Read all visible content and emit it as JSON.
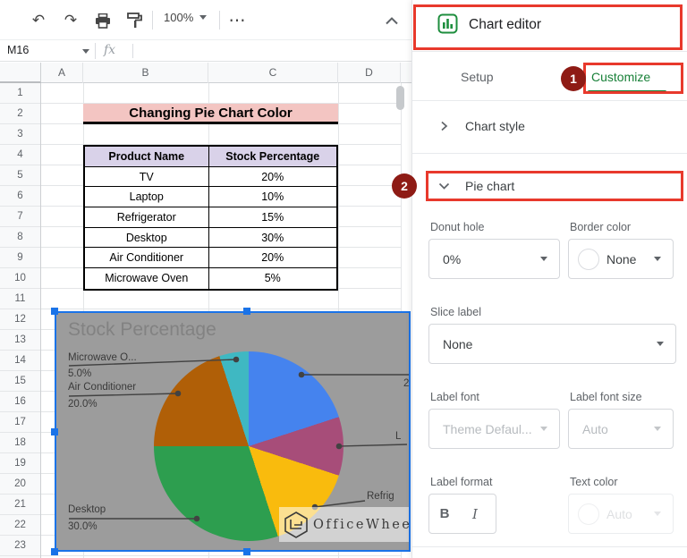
{
  "toolbar": {
    "zoom_level": "100%",
    "more": "⋯"
  },
  "formula_bar": {
    "name_box": "M16",
    "fx": "fx"
  },
  "grid": {
    "columns": [
      "A",
      "B",
      "C",
      "D"
    ],
    "rows": [
      "1",
      "2",
      "3",
      "4",
      "5",
      "6",
      "7",
      "8",
      "9",
      "10",
      "11",
      "12",
      "13",
      "14",
      "15",
      "16",
      "17",
      "18",
      "19",
      "20",
      "21",
      "22",
      "23"
    ]
  },
  "sheet": {
    "title": "Changing Pie Chart Color",
    "table": {
      "headers": [
        "Product Name",
        "Stock Percentage"
      ],
      "rows": [
        [
          "TV",
          "20%"
        ],
        [
          "Laptop",
          "10%"
        ],
        [
          "Refrigerator",
          "15%"
        ],
        [
          "Desktop",
          "30%"
        ],
        [
          "Air Conditioner",
          "20%"
        ],
        [
          "Microwave Oven",
          "5%"
        ]
      ]
    }
  },
  "chart": {
    "title": "Stock Percentage",
    "labels": {
      "microwave_name": "Microwave O...",
      "microwave_pct": "5.0%",
      "air_name": "Air Conditioner",
      "air_pct": "20.0%",
      "desktop_name": "Desktop",
      "desktop_pct": "30.0%",
      "laptop_clipped": "L",
      "refrigerator_clipped": "Refrig",
      "tv_pct_clipped": "2"
    },
    "watermark": "OfficeWheel"
  },
  "chart_data": {
    "type": "pie",
    "title": "Stock Percentage",
    "categories": [
      "TV",
      "Laptop",
      "Refrigerator",
      "Desktop",
      "Air Conditioner",
      "Microwave Oven"
    ],
    "values": [
      20,
      10,
      15,
      30,
      20,
      5
    ],
    "colors": [
      "#4583ee",
      "#a74d79",
      "#f9bb0d",
      "#2d9e4f",
      "#b05f07",
      "#3fb8c2"
    ],
    "start_angle_deg": 0,
    "legend": "none",
    "label_style": "callout lines with name and percent"
  },
  "panel": {
    "title": "Chart editor",
    "tabs": {
      "setup": "Setup",
      "customize": "Customize"
    },
    "badges": {
      "step1": "1",
      "step2": "2"
    },
    "sections": {
      "chart_style": "Chart style",
      "pie_chart": "Pie chart"
    },
    "fields": {
      "donut_hole": {
        "label": "Donut hole",
        "value": "0%"
      },
      "border_color": {
        "label": "Border color",
        "value": "None"
      },
      "slice_label": {
        "label": "Slice label",
        "value": "None"
      },
      "label_font": {
        "label": "Label font",
        "value": "Theme Defaul..."
      },
      "label_font_size": {
        "label": "Label font size",
        "value": "Auto"
      },
      "label_format": {
        "label": "Label format",
        "bold": "B",
        "italic": "I"
      },
      "text_color": {
        "label": "Text color",
        "value": "Auto"
      }
    }
  },
  "colors": {
    "selection_blue": "#1a73e8",
    "annotation_red": "#e8392c",
    "badge_maroon": "#8e1b15",
    "customize_green": "#188038",
    "chart_bg_gray": "#9c9c9c",
    "title_cell_pink": "#f3c5c2",
    "table_header_lavender": "#d9d2e9"
  }
}
